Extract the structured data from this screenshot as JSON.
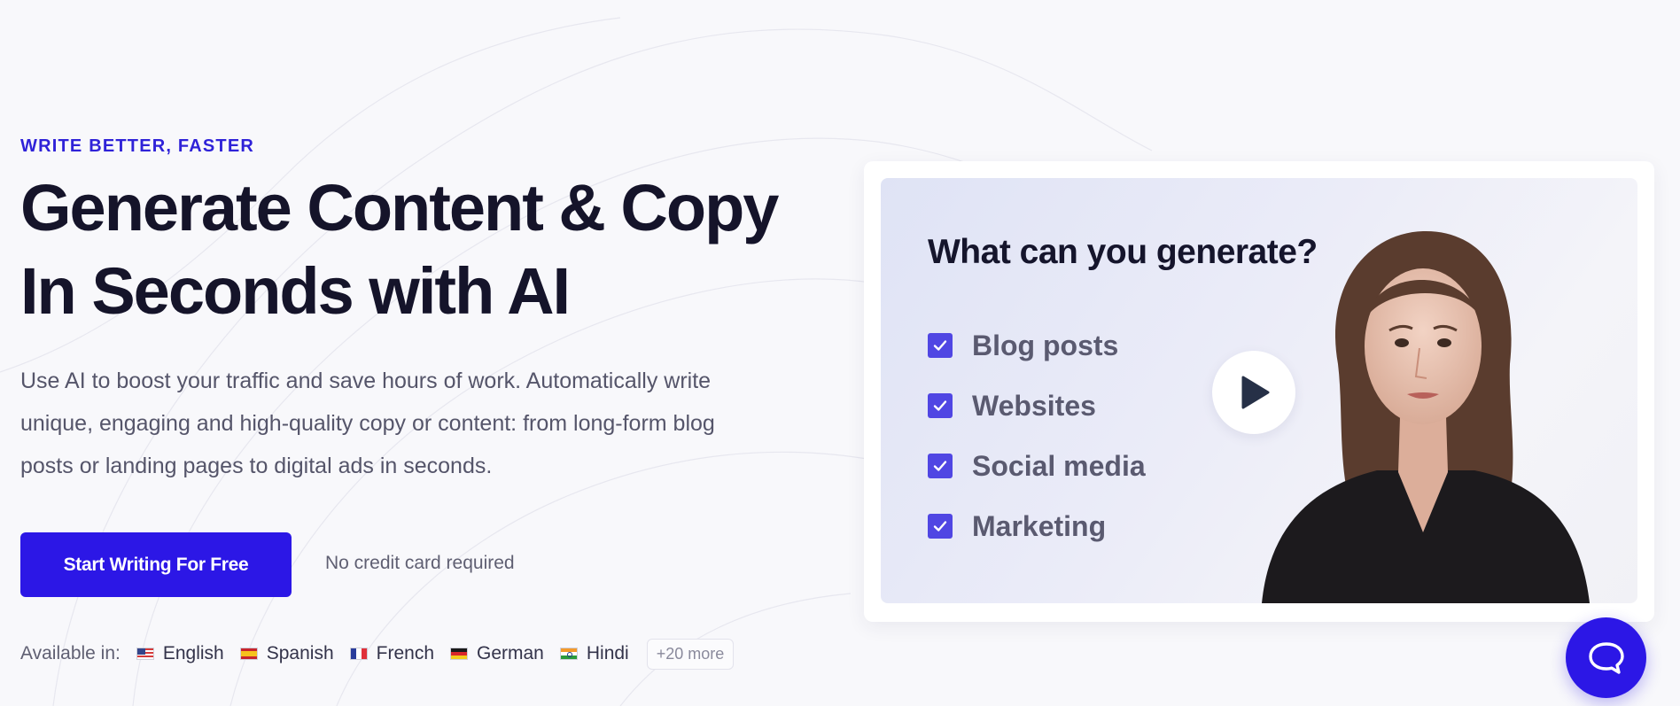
{
  "hero": {
    "eyebrow": "WRITE BETTER, FASTER",
    "headline_line1": "Generate Content & Copy",
    "headline_line2": "In Seconds with AI",
    "subcopy": "Use AI to boost your traffic and save hours of work. Automatically write unique, engaging and high-quality copy or content: from long-form blog posts or landing pages to digital ads in seconds.",
    "cta_label": "Start Writing For Free",
    "no_card_note": "No credit card required"
  },
  "languages": {
    "label": "Available in:",
    "items": [
      {
        "name": "English",
        "flag": "us-flag-icon"
      },
      {
        "name": "Spanish",
        "flag": "spain-flag-icon"
      },
      {
        "name": "French",
        "flag": "france-flag-icon"
      },
      {
        "name": "German",
        "flag": "germany-flag-icon"
      },
      {
        "name": "Hindi",
        "flag": "india-flag-icon"
      }
    ],
    "more": "+20 more"
  },
  "video": {
    "title": "What can you generate?",
    "items": [
      "Blog posts",
      "Websites",
      "Social media",
      "Marketing"
    ],
    "play_icon": "play-icon"
  },
  "chat": {
    "icon": "chat-bubble-icon"
  },
  "colors": {
    "accent": "#2c17e6",
    "eyebrow": "#2f22d8",
    "checkbox": "#5046e3",
    "headline": "#15142a"
  }
}
